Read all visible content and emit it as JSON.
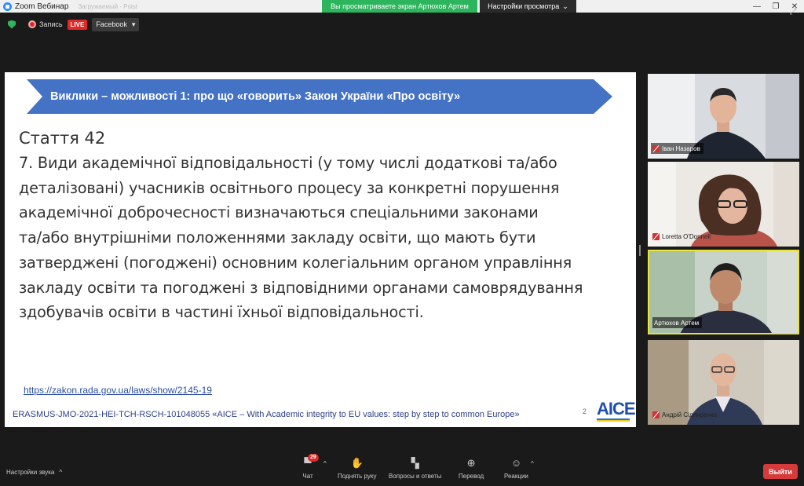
{
  "window": {
    "title": "Zoom Вебинар",
    "ghost_text": "Загружаемый · Poist",
    "share_banner": "Вы просматриваете экран Артюхов Артем",
    "view_settings": "Настройки просмотра",
    "view_settings_chevron": "⌄",
    "controls": [
      "—",
      "❐",
      "✕"
    ]
  },
  "topbar": {
    "record_label": "Запись",
    "live_label": "LIVE",
    "facebook_label": "Facebook",
    "facebook_chevron": "▾"
  },
  "slide": {
    "banner_title": "Виклики – можливості 1: про що «говорить» Закон України «Про освіту»",
    "banner_color": "#4472c4",
    "article_title": "Стаття 42",
    "article_lines": [
      "7. Види академічної відповідальності (у тому числі додаткові та/або",
      "деталізовані) учасників освітнього процесу за конкретні порушення",
      "академічної доброчесності визначаються спеціальними законами",
      "та/або внутрішніми положеннями закладу освіти, що мають бути",
      "затверджені (погоджені) основним колегіальним органом управління",
      "закладу освіти та погоджені з відповідними органами самоврядування",
      "здобувачів освіти в частині їхньої відповідальності."
    ],
    "link_text": "https://zakon.rada.gov.ua/laws/show/2145-19",
    "footer_text": "ERASMUS-JMO-2021-HEI-TCH-RSCH-101048055 «AICE – With Academic integrity to EU values: step by step to common Europe»",
    "page_number": "2",
    "logo_text": "AICE"
  },
  "participants": [
    {
      "name": "Іван Назаров",
      "muted": true,
      "active": false
    },
    {
      "name": "Loretta O'Donnell",
      "muted": true,
      "active": false
    },
    {
      "name": "Артюхов Артем",
      "muted": false,
      "active": true
    },
    {
      "name": "Андрій Сідляренко",
      "muted": true,
      "active": false
    }
  ],
  "bottombar": {
    "sound_settings": "Настройки звука",
    "chevron_up": "^",
    "chat_label": "Чат",
    "chat_badge": "29",
    "raise_hand_label": "Поднять руку",
    "qa_label": "Вопросы и ответы",
    "translation_label": "Перевод",
    "reactions_label": "Реакции",
    "leave_label": "Выйти"
  },
  "colors": {
    "accent_green": "#2db55d",
    "live_red": "#e02828",
    "active_speaker": "#e8e43a",
    "leave_red": "#d73a3a"
  }
}
